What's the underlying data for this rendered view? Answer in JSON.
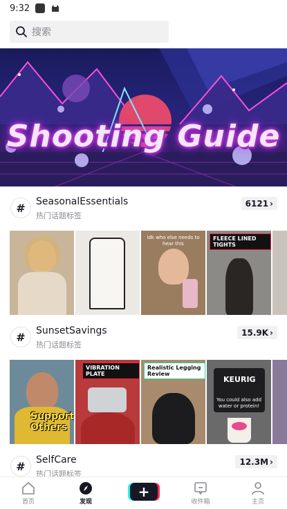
{
  "status_bar": {
    "time": "9:32"
  },
  "search": {
    "placeholder": "搜索"
  },
  "banner": {
    "title": "Shooting Guide"
  },
  "topics": [
    {
      "name": "SeasonalEssentials",
      "subtitle": "热门话题标签",
      "count": "6121",
      "thumbnails": [
        {
          "label": ""
        },
        {
          "label": ""
        },
        {
          "label": "idk who else needs to hear this"
        },
        {
          "label": "FLEECE LINED TIGHTS"
        }
      ]
    },
    {
      "name": "SunsetSavings",
      "subtitle": "热门话题标签",
      "count": "15.9K",
      "thumbnails": [
        {
          "label": "Support Others"
        },
        {
          "label": "VIBRATION PLATE"
        },
        {
          "label": "Realistic Legging Review"
        },
        {
          "label": "KEURIG",
          "caption": "You could also add water or protein!"
        }
      ]
    },
    {
      "name": "SelfCare",
      "subtitle": "热门话题标签",
      "count": "12.3M"
    }
  ],
  "bottom_nav": {
    "items": [
      {
        "label": "首页"
      },
      {
        "label": "发现"
      },
      {
        "label": ""
      },
      {
        "label": "收件箱"
      },
      {
        "label": "主页"
      }
    ]
  }
}
